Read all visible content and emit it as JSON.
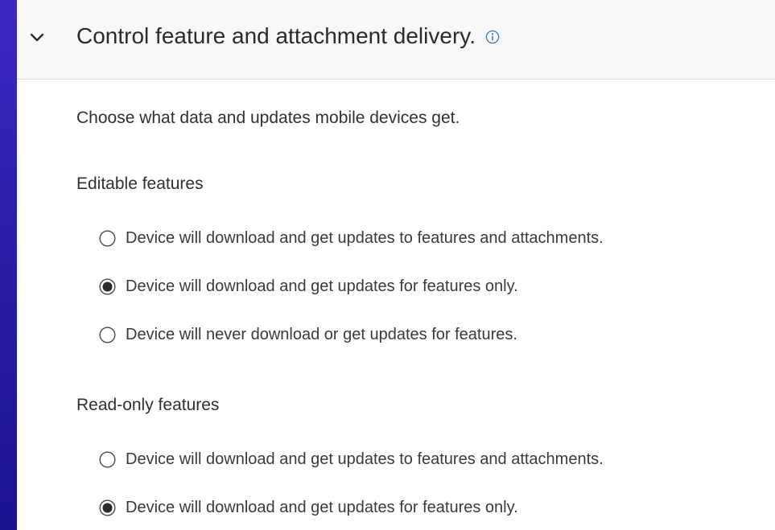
{
  "section": {
    "title": "Control feature and attachment delivery.",
    "description": "Choose what data and updates mobile devices get."
  },
  "groups": [
    {
      "title": "Editable features",
      "options": [
        {
          "label": "Device will download and get updates to features and attachments.",
          "selected": false
        },
        {
          "label": "Device will download and get updates for features only.",
          "selected": true
        },
        {
          "label": "Device will never download or get updates for features.",
          "selected": false
        }
      ]
    },
    {
      "title": "Read-only features",
      "options": [
        {
          "label": "Device will download and get updates to features and attachments.",
          "selected": false
        },
        {
          "label": "Device will download and get updates for features only.",
          "selected": true
        }
      ]
    }
  ],
  "colors": {
    "info_icon": "#2f7fc1",
    "radio_border": "#4a4a4a",
    "radio_fill": "#2b2b2b"
  },
  "icons": {
    "expand": "chevron-down-icon",
    "info": "info-icon",
    "radio_unselected": "radio-unchecked-icon",
    "radio_selected": "radio-checked-icon"
  }
}
